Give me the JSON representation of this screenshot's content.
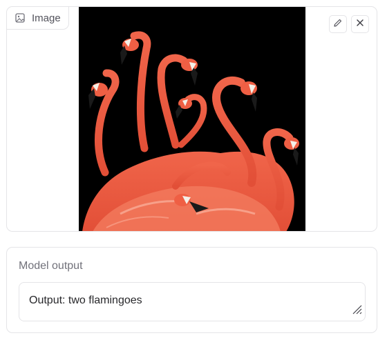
{
  "image_panel": {
    "label": "Image",
    "label_icon": "image-icon",
    "edit_icon": "pencil-icon",
    "close_icon": "close-icon",
    "content": "flamingos-photo"
  },
  "output_panel": {
    "label": "Model output",
    "value": "Output: two flamingoes",
    "resize_icon": "resize-grip-icon"
  },
  "colors": {
    "border": "#e4e4e7",
    "label_text": "#71717a",
    "body_text": "#27272a",
    "photo_bg": "#000000",
    "flamingo": "#ee5a3f"
  }
}
